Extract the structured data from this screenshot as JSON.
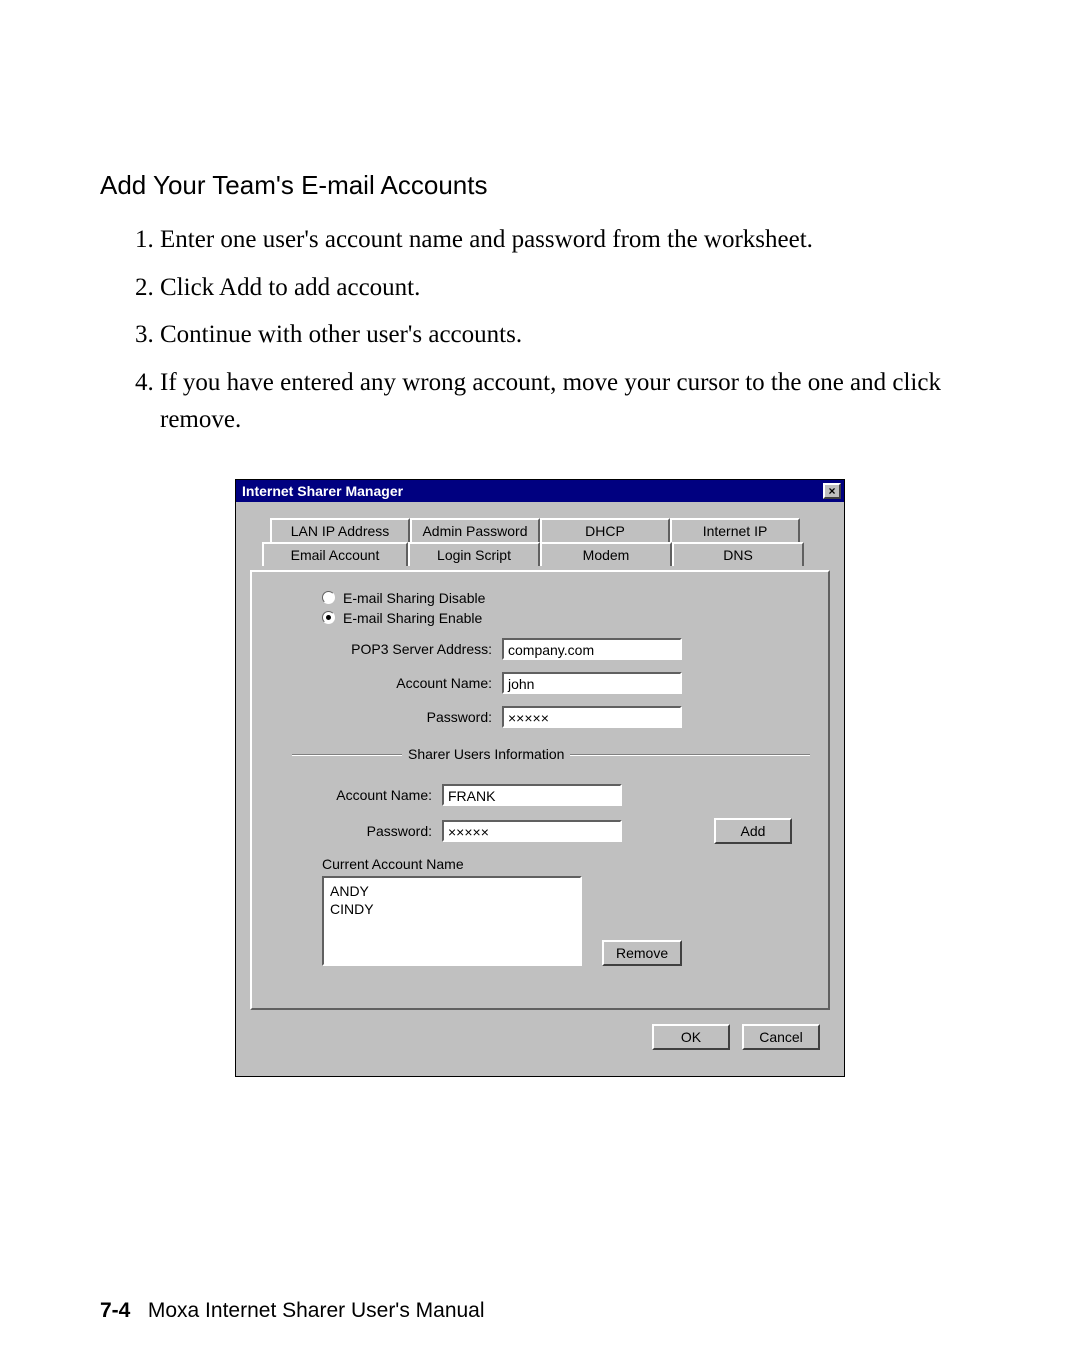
{
  "heading": "Add Your Team's E-mail Accounts",
  "steps": [
    "Enter one user's account name and password from the worksheet.",
    "Click Add to add account.",
    "Continue with other user's accounts.",
    "If you have entered any wrong account, move your cursor to the one and click remove."
  ],
  "dialog": {
    "title": "Internet Sharer Manager",
    "close_glyph": "×",
    "tabs_back": [
      "LAN IP Address",
      "Admin Password",
      "DHCP",
      "Internet IP"
    ],
    "tabs_front": [
      "Email Account",
      "Login Script",
      "Modem",
      "DNS"
    ],
    "radio_disable": "E-mail Sharing Disable",
    "radio_enable": "E-mail Sharing Enable",
    "pop3_label": "POP3 Server Address:",
    "pop3_value": "company.com",
    "main_account_label": "Account Name:",
    "main_account_value": "john",
    "main_password_label": "Password:",
    "main_password_value": "×××××",
    "fieldset_legend": "Sharer Users Information",
    "su_account_label": "Account Name:",
    "su_account_value": "FRANK",
    "su_password_label": "Password:",
    "su_password_value": "×××××",
    "add_button": "Add",
    "current_label": "Current Account Name",
    "accounts": [
      "ANDY",
      "CINDY"
    ],
    "remove_button": "Remove",
    "ok_button": "OK",
    "cancel_button": "Cancel"
  },
  "footer": {
    "page": "7-4",
    "title": "Moxa Internet Sharer User's Manual"
  }
}
